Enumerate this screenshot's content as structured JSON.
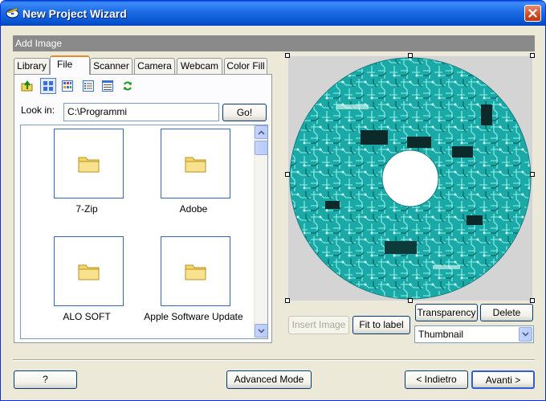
{
  "window": {
    "title": "New Project Wizard"
  },
  "section": {
    "header": "Add Image"
  },
  "tabs": [
    {
      "label": "Library"
    },
    {
      "label": "File"
    },
    {
      "label": "Scanner"
    },
    {
      "label": "Camera"
    },
    {
      "label": "Webcam"
    },
    {
      "label": "Color Fill"
    }
  ],
  "active_tab": "File",
  "toolbar": {
    "icons": [
      "folder-up-icon",
      "large-icons-view-icon",
      "thumbnail-view-icon",
      "list-view-icon",
      "details-view-icon",
      "refresh-icon"
    ]
  },
  "lookin": {
    "label": "Look in:",
    "value": "C:\\Programmi",
    "go_label": "Go!"
  },
  "files": [
    {
      "name": "7-Zip"
    },
    {
      "name": "Adobe"
    },
    {
      "name": "ALO SOFT"
    },
    {
      "name": "Apple Software Update"
    }
  ],
  "preview": {
    "image": "circuit-board-cd-label"
  },
  "actions": {
    "insert_image": "Insert Image",
    "fit_to_label": "Fit to label",
    "transparency": "Transparency",
    "delete": "Delete",
    "view_mode": "Thumbnail"
  },
  "footer": {
    "help": "?",
    "advanced": "Advanced Mode",
    "back": "< Indietro",
    "next": "Avanti >"
  },
  "colors": {
    "titlebar": "#0752d0",
    "dialog_bg": "#ece9d8",
    "section_header": "#8a8a8a",
    "circuit_teal": "#1fb3b1",
    "selection_blue": "#316ac5"
  }
}
